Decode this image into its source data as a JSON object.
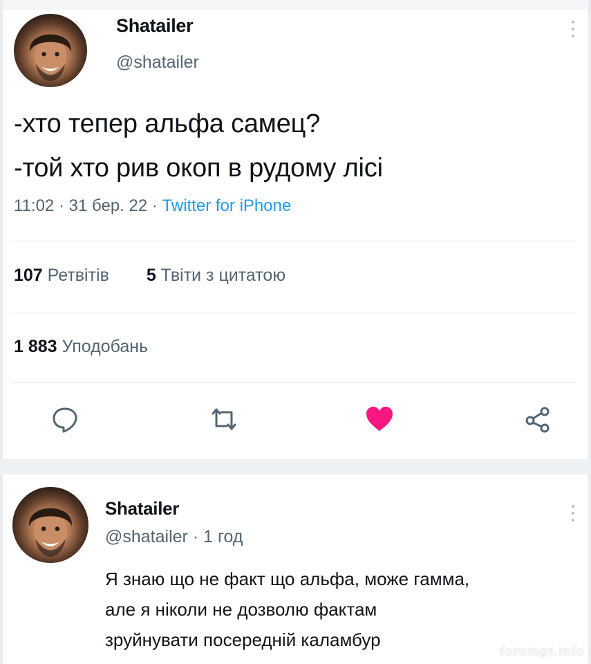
{
  "colors": {
    "text": "#0f1419",
    "secondary": "#536471",
    "link": "#1d9bf0",
    "like": "#f91880",
    "divider": "#dfe3e7"
  },
  "tweet": {
    "author_name": "Shatailer",
    "handle": "@shatailer",
    "text_lines": [
      "-хто тепер альфа самец?",
      "-той хто рив окоп в рудому лісі"
    ],
    "time": "11:02",
    "date": "31 бер. 22",
    "source": "Twitter for iPhone",
    "sep": "·",
    "retweets_count": "107",
    "retweets_label": "Ретвітів",
    "quotes_count": "5",
    "quotes_label": "Твіти з цитатою",
    "likes_count": "1 883",
    "likes_label": "Уподобань",
    "actions": [
      "reply-icon",
      "retweet-icon",
      "like-icon",
      "share-icon"
    ]
  },
  "reply": {
    "author_name": "Shatailer",
    "handle": "@shatailer",
    "age": "1 год",
    "text_lines": [
      "Я знаю що не факт що альфа, може гамма,",
      "але я ніколи не дозволю фактам",
      "зруйнувати посередній каламбур"
    ]
  },
  "watermark": "forumgs.info"
}
